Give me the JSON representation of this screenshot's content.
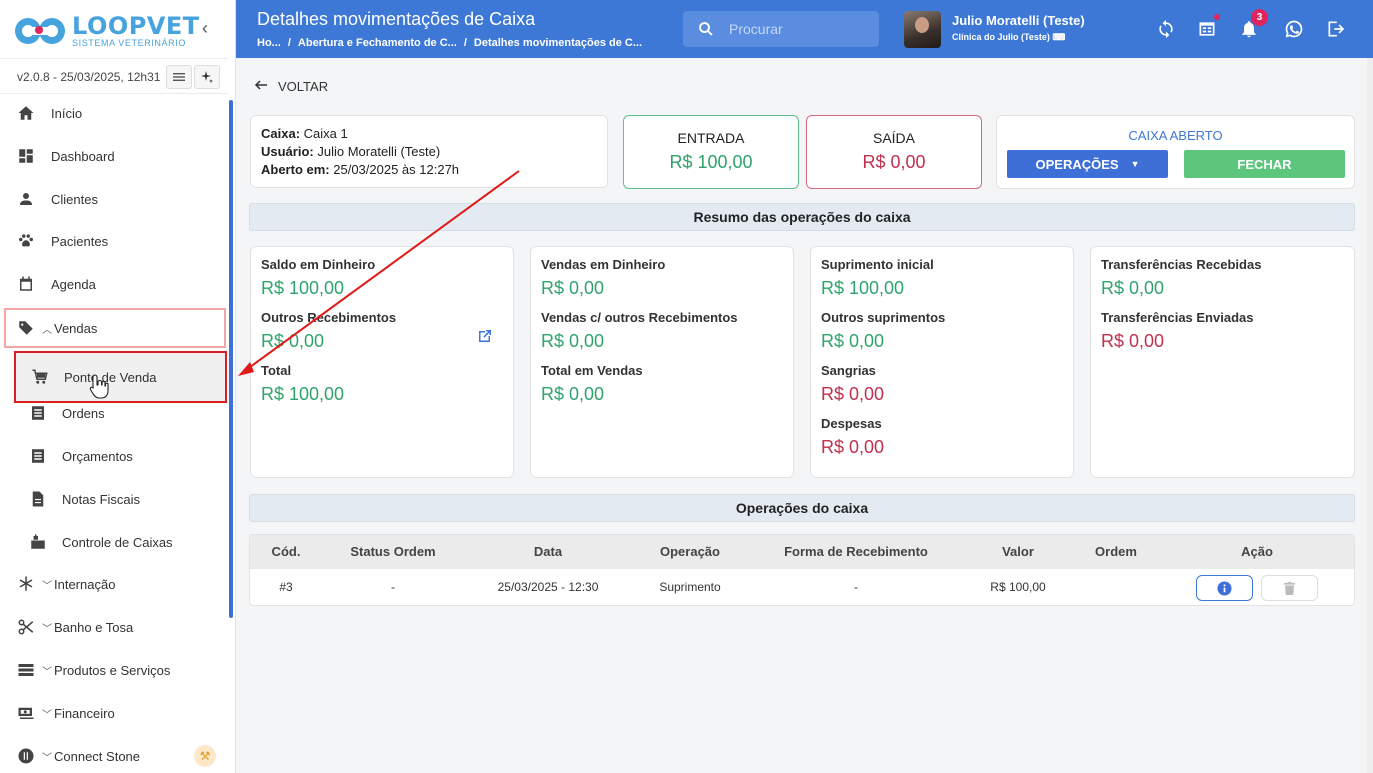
{
  "sidebar": {
    "logo_title": "LOOPVET",
    "logo_subtitle": "SISTEMA VETERINÁRIO",
    "version": "v2.0.8 - 25/03/2025, 12h31",
    "items": [
      {
        "label": "Início",
        "icon": "home-icon"
      },
      {
        "label": "Dashboard",
        "icon": "dashboard-icon"
      },
      {
        "label": "Clientes",
        "icon": "person-icon"
      },
      {
        "label": "Pacientes",
        "icon": "paw-icon"
      },
      {
        "label": "Agenda",
        "icon": "calendar-icon"
      },
      {
        "label": "Vendas",
        "icon": "tag-icon"
      },
      {
        "label": "Ponto de Venda",
        "icon": "cart-icon"
      },
      {
        "label": "Ordens",
        "icon": "list-icon"
      },
      {
        "label": "Orçamentos",
        "icon": "list-icon"
      },
      {
        "label": "Notas Fiscais",
        "icon": "document-icon"
      },
      {
        "label": "Controle de Caixas",
        "icon": "cash-register-icon"
      },
      {
        "label": "Internação",
        "icon": "asterisk-icon"
      },
      {
        "label": "Banho e Tosa",
        "icon": "scissors-icon"
      },
      {
        "label": "Produtos e Serviços",
        "icon": "stack-icon"
      },
      {
        "label": "Financeiro",
        "icon": "money-icon"
      },
      {
        "label": "Connect Stone",
        "icon": "stone-icon"
      }
    ]
  },
  "header": {
    "title": "Detalhes movimentações de Caixa",
    "breadcrumb": [
      "Ho...",
      "/",
      "Abertura e Fechamento de C...",
      "/",
      "Detalhes movimentações de C..."
    ],
    "search_placeholder": "Procurar",
    "user_name": "Julio Moratelli (Teste)",
    "clinic": "Clínica do Julio (Teste)",
    "notifications": "3",
    "accent": "#3d78d6"
  },
  "main": {
    "back_label": "VOLTAR",
    "info": {
      "caixa_label": "Caixa:",
      "caixa_value": "Caixa 1",
      "usuario_label": "Usuário:",
      "usuario_value": "Julio Moratelli (Teste)",
      "aberto_label": "Aberto em:",
      "aberto_value": "25/03/2025 às 12:27h"
    },
    "entrada_label": "ENTRADA",
    "entrada_value": "R$ 100,00",
    "saida_label": "SAÍDA",
    "saida_value": "R$ 0,00",
    "status": "CAIXA ABERTO",
    "operacoes_btn": "OPERAÇÕES",
    "fechar_btn": "FECHAR",
    "resumo_title": "Resumo das operações do caixa",
    "resumo": {
      "col1": [
        {
          "label": "Saldo em Dinheiro",
          "value": "R$ 100,00"
        },
        {
          "label": "Outros Recebimentos",
          "value": "R$ 0,00"
        },
        {
          "label": "Total",
          "value": "R$ 100,00"
        }
      ],
      "col2": [
        {
          "label": "Vendas em Dinheiro",
          "value": "R$ 0,00"
        },
        {
          "label": "Vendas c/ outros Recebimentos",
          "value": "R$ 0,00"
        },
        {
          "label": "Total em Vendas",
          "value": "R$ 0,00"
        }
      ],
      "col3": [
        {
          "label": "Suprimento inicial",
          "value": "R$ 100,00"
        },
        {
          "label": "Outros suprimentos",
          "value": "R$ 0,00"
        },
        {
          "label": "Sangrias",
          "value": "R$ 0,00"
        },
        {
          "label": "Despesas",
          "value": "R$ 0,00"
        }
      ],
      "col4": [
        {
          "label": "Transferências Recebidas",
          "value": "R$ 0,00"
        },
        {
          "label": "Transferências Enviadas",
          "value": "R$ 0,00"
        }
      ]
    },
    "operacoes_title": "Operações do caixa",
    "table": {
      "headers": [
        "Cód.",
        "Status Ordem",
        "Data",
        "Operação",
        "Forma de Recebimento",
        "Valor",
        "Ordem",
        "Ação"
      ],
      "rows": [
        [
          "#3",
          "-",
          "25/03/2025 - 12:30",
          "Suprimento",
          "-",
          "R$ 100,00",
          ""
        ]
      ]
    }
  }
}
